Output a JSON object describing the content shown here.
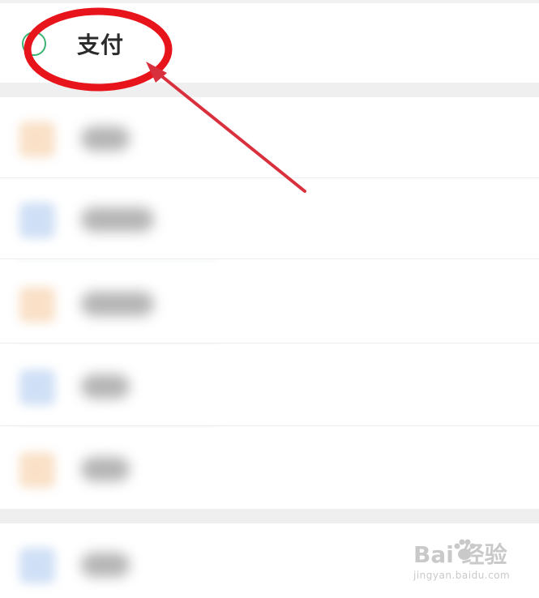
{
  "header": {
    "pay_label": "支付",
    "icon": "circle-check-icon",
    "accent_color": "#3cb371"
  },
  "menu": {
    "items": [
      {
        "icon": "blurred-app-icon",
        "icon_color": "#f5c89a"
      },
      {
        "icon": "blurred-app-icon",
        "icon_color": "#a9c6ee"
      },
      {
        "icon": "blurred-app-icon",
        "icon_color": "#f5c89a"
      },
      {
        "icon": "blurred-app-icon",
        "icon_color": "#a9c6ee"
      },
      {
        "icon": "blurred-app-icon",
        "icon_color": "#f5c89a"
      },
      {
        "icon": "blurred-app-icon",
        "icon_color": "#a9c6ee"
      }
    ]
  },
  "annotation": {
    "ellipse_color": "#e8141b",
    "arrow_color": "#d9303e"
  },
  "watermark": {
    "brand": "Bai 经验",
    "url": "jingyan.baidu.com"
  }
}
